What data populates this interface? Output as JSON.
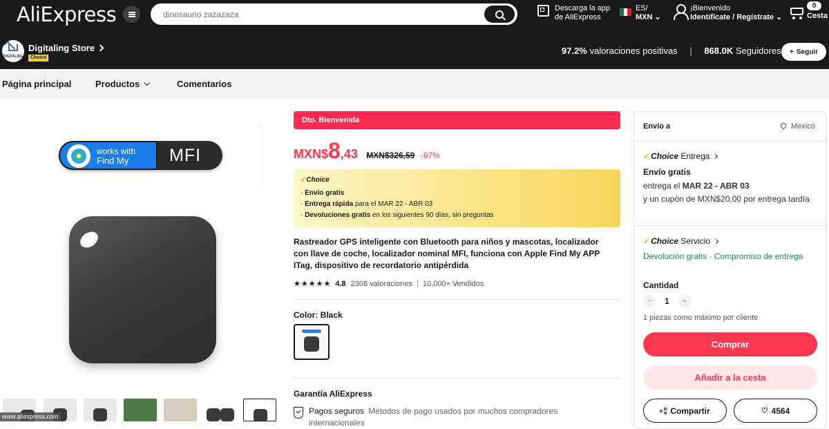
{
  "header": {
    "logo": "AliExpress",
    "search": {
      "placeholder": "dinosaurio zazazaza"
    },
    "app_download": {
      "line1": "Descarga la app",
      "line2": "de AliExpress"
    },
    "locale": {
      "language": "ES/",
      "currency": "MXN"
    },
    "account": {
      "greeting": "¡Bienvenido",
      "action": "Identifícate / Regístrate"
    },
    "cart": {
      "count": "0",
      "label": "Cesta"
    }
  },
  "store": {
    "avatar_text": "DIGITALING",
    "name": "Digitaling Store",
    "badge": "Choice",
    "rating_value": "97.2%",
    "rating_label": "valoraciones positivas",
    "followers_value": "868.0K",
    "followers_label": "Seguidores",
    "follow_label": "Seguir"
  },
  "nav": {
    "items": [
      {
        "label": "Página principal"
      },
      {
        "label": "Productos"
      },
      {
        "label": "Comentarios"
      }
    ]
  },
  "gallery": {
    "badge_small": "works with",
    "badge_findmy": "Find My",
    "badge_mfi": "MFI",
    "watermark": "www.aliexpress.com",
    "thumbnail_count": 7
  },
  "product": {
    "promo_banner": "Dto. Bienvenida",
    "price": {
      "currency": "MXN$",
      "integer": "8",
      "decimal": ",43",
      "original": "MXN$326,59",
      "discount": "-97%"
    },
    "choice": {
      "logo": "Choice",
      "lines": [
        {
          "bold": "Envío gratis",
          "rest": ""
        },
        {
          "bold": "Entrega rápida",
          "rest": "para el MAR 22 - ABR 03"
        },
        {
          "bold": "Devoluciones gratis",
          "rest": "en los siguientes 90 días, sin preguntas"
        }
      ]
    },
    "title": "Rastreador GPS inteligente con Bluetooth para niños y mascotas, localizador con llave de coche, localizador nominal MFI, funciona con Apple Find My APP ITag, dispositivo de recordatorio antipérdida",
    "rating": {
      "stars": 5,
      "value": "4.8",
      "reviews": "2308 valoraciones",
      "sold": "10.000+ Vendidos"
    },
    "color_label": "Color: Black",
    "guarantee_title": "Garantía AliExpress",
    "payment": {
      "title": "Pagos seguros",
      "desc": "Métodos de pago usados por muchos compradores internacionales"
    }
  },
  "sidebar": {
    "ship_to": "Envío a",
    "country": "Mexico",
    "delivery_choice": "Choice",
    "delivery_title": "Entrega",
    "free_shipping": "Envío gratis",
    "delivery_prefix": "entrega el",
    "delivery_dates": "MAR 22 - ABR 03",
    "coupon_text": "y un cupón de MXN$20,00 por entrega tardía",
    "service_choice": "Choice",
    "service_title": "Servicio",
    "service_link1": "Devolución gratis",
    "service_sep": " · ",
    "service_link2": "Compromiso de entrega",
    "quantity_label": "Cantidad",
    "quantity_value": "1",
    "quantity_minus": "−",
    "quantity_plus": "+",
    "quantity_note": "1 piezas como máximo por cliente",
    "buy_label": "Comprar",
    "add_cart_label": "Añadir a la cesta",
    "share_label": "Compartir",
    "wishlist_count": "4564"
  },
  "colors": {
    "brand_dark": "#191919",
    "accent_red": "#fd384f",
    "choice_yellow": "#f5d033",
    "link_green": "#1a8a6b"
  }
}
